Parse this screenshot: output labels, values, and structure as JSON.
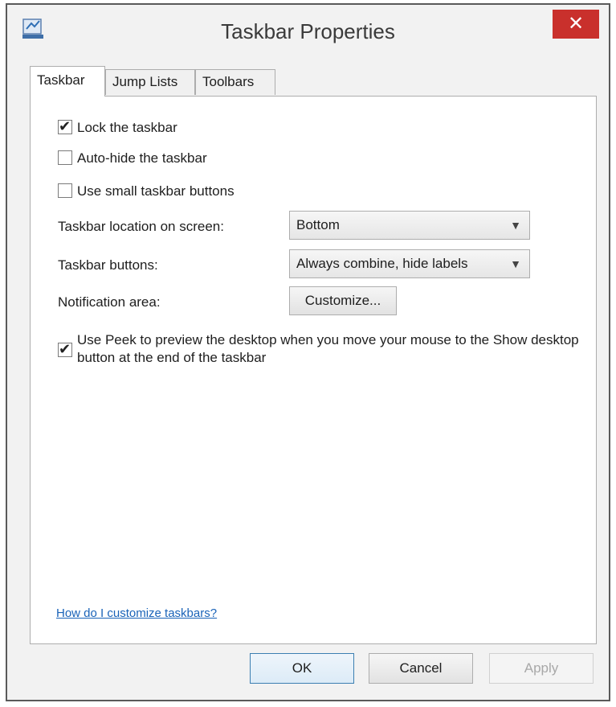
{
  "window": {
    "title": "Taskbar Properties",
    "close_label": "✕"
  },
  "tabs": [
    {
      "label": "Taskbar",
      "active": true
    },
    {
      "label": "Jump Lists",
      "active": false
    },
    {
      "label": "Toolbars",
      "active": false
    }
  ],
  "options": {
    "lock_taskbar": {
      "label": "Lock the taskbar",
      "checked": true
    },
    "auto_hide": {
      "label": "Auto-hide the taskbar",
      "checked": false
    },
    "small_buttons": {
      "label": "Use small taskbar buttons",
      "checked": false
    },
    "use_peek": {
      "label": "Use Peek to preview the desktop when you move your mouse to the Show desktop button at the end of the taskbar",
      "checked": true
    }
  },
  "fields": {
    "location_label": "Taskbar location on screen:",
    "location_value": "Bottom",
    "buttons_label": "Taskbar buttons:",
    "buttons_value": "Always combine, hide labels",
    "notification_label": "Notification area:",
    "customize_label": "Customize..."
  },
  "help_link": "How do I customize taskbars?",
  "footer": {
    "ok": "OK",
    "cancel": "Cancel",
    "apply": "Apply"
  },
  "icons": {
    "title": "taskbar-properties-icon",
    "close": "close-icon",
    "checkmark": "checkmark-icon",
    "dropdown": "chevron-down-icon"
  },
  "colors": {
    "close_button": "#c9302c",
    "link": "#1a63b8",
    "ok_border": "#3c7fb1"
  }
}
